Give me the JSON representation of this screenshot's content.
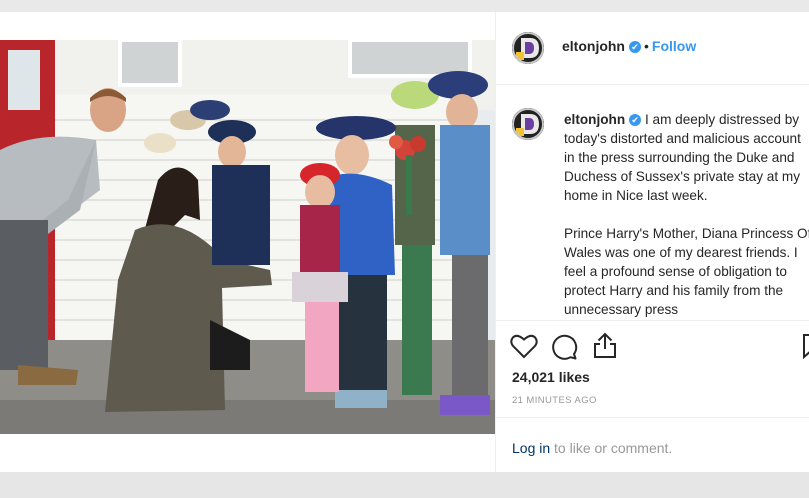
{
  "post": {
    "username": "eltonjohn",
    "verified_glyph": "✔",
    "separator": "•",
    "follow_label": "Follow",
    "more_glyph": "•••",
    "caption_paragraphs": [
      "I am deeply distressed by today's distorted and malicious account in the press surrounding the Duke and Duchess of Sussex's private stay at my home in Nice last week.",
      "Prince Harry's Mother, Diana Princess Of Wales was one of my dearest friends. I feel a profound sense of obligation to protect Harry and his family from the unnecessary press"
    ],
    "likes_text": "24,021 likes",
    "time_text": "21 MINUTES AGO",
    "login_link": "Log in",
    "login_suffix": " to like or comment."
  },
  "icons": {
    "like": "heart-icon",
    "comment": "comment-icon",
    "share": "share-icon",
    "save": "bookmark-icon"
  },
  "colors": {
    "accent": "#3897f0",
    "link": "#003569",
    "muted": "#999999",
    "text": "#262626"
  }
}
